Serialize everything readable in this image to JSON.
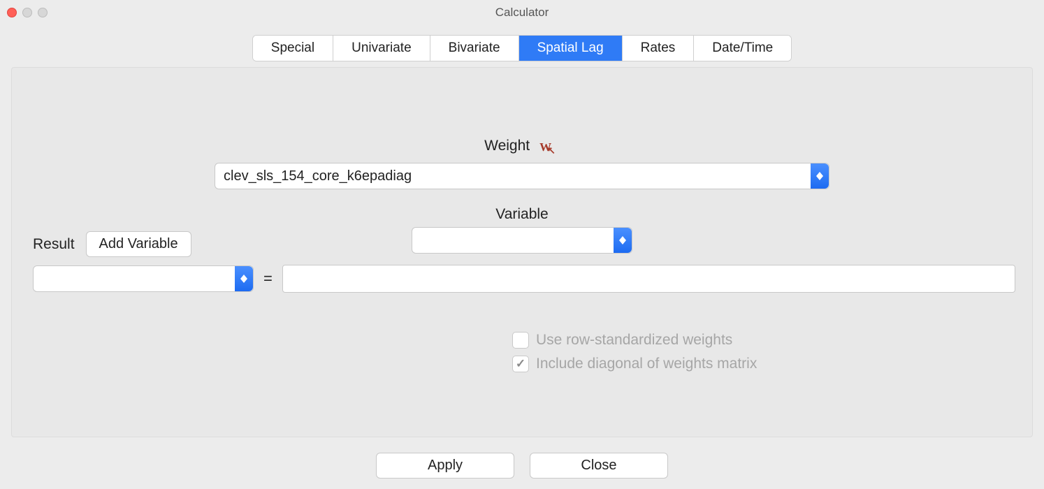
{
  "window": {
    "title": "Calculator"
  },
  "tabs": {
    "items": [
      {
        "label": "Special"
      },
      {
        "label": "Univariate"
      },
      {
        "label": "Bivariate"
      },
      {
        "label": "Spatial Lag"
      },
      {
        "label": "Rates"
      },
      {
        "label": "Date/Time"
      }
    ],
    "active_index": 3
  },
  "weight": {
    "label": "Weight",
    "icon_name": "weights-manager-icon",
    "value": "clev_sls_154_core_k6epadiag"
  },
  "variable": {
    "label": "Variable",
    "value": ""
  },
  "result": {
    "label": "Result",
    "add_button_label": "Add Variable",
    "value": "",
    "equals": "=",
    "expression": ""
  },
  "options": {
    "row_standardized": {
      "label": "Use row-standardized weights",
      "checked": false,
      "enabled": false
    },
    "include_diagonal": {
      "label": "Include diagonal of weights matrix",
      "checked": true,
      "enabled": false
    }
  },
  "buttons": {
    "apply": "Apply",
    "close": "Close"
  }
}
